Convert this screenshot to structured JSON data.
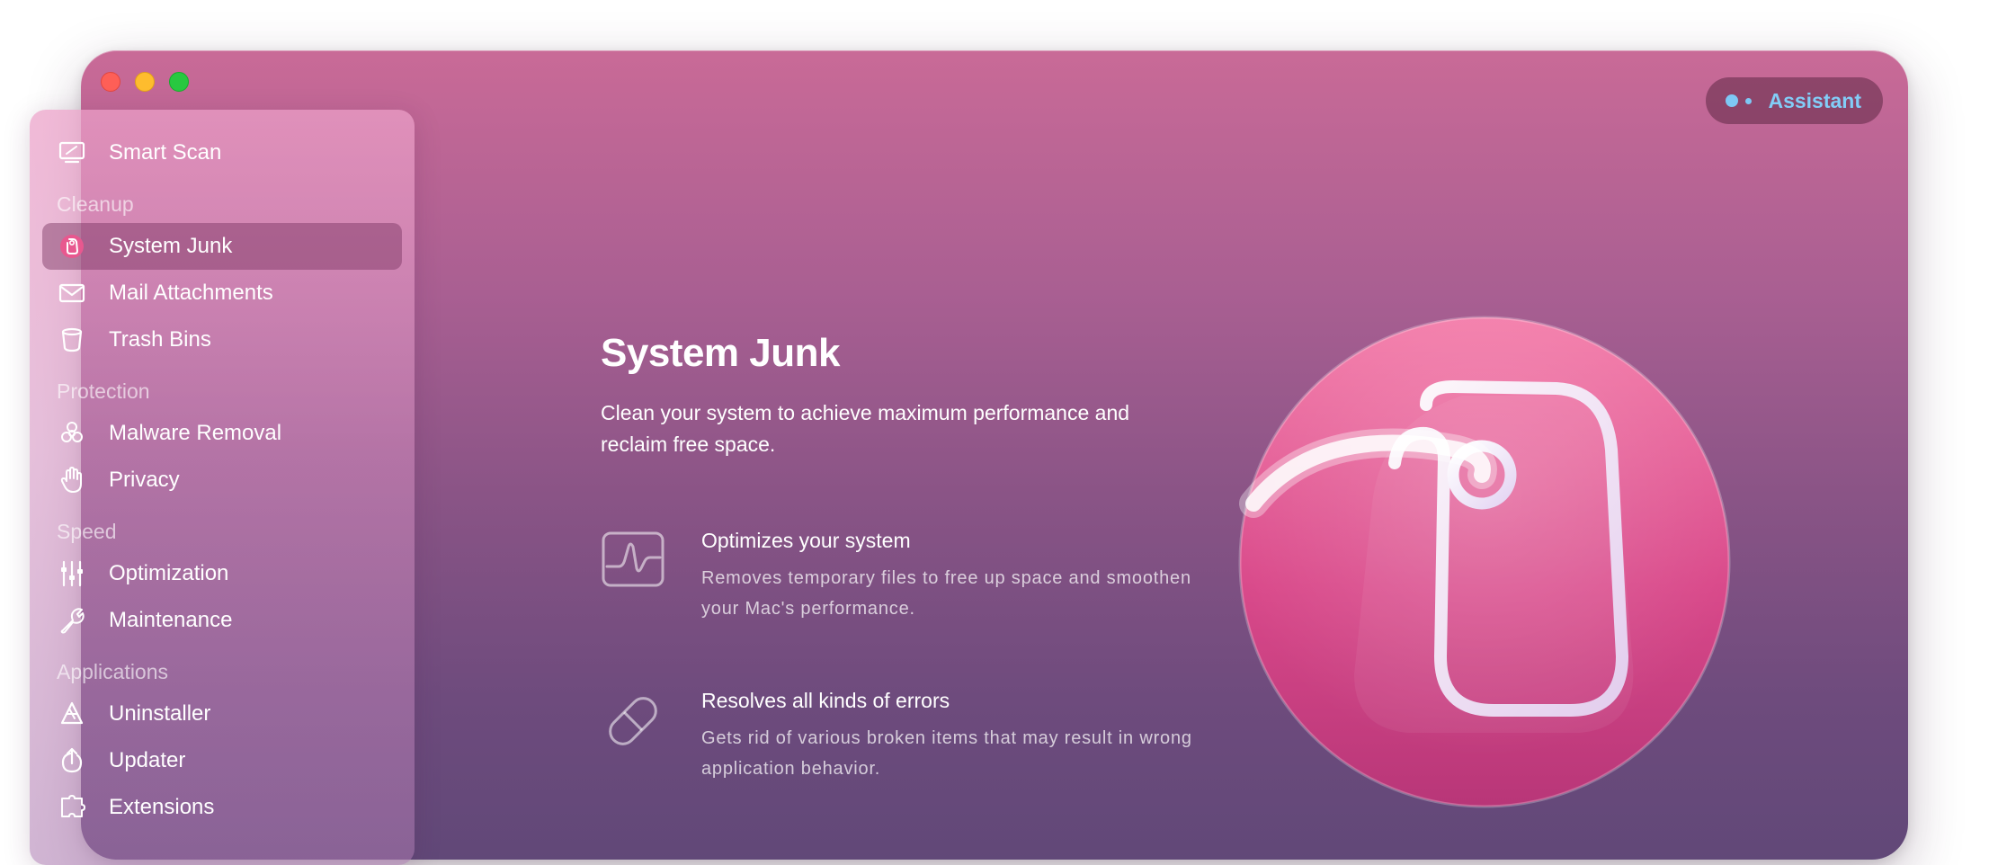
{
  "window": {
    "assistant_label": "Assistant"
  },
  "sidebar": {
    "top_item": {
      "label": "Smart Scan",
      "icon": "smart-scan-icon"
    },
    "sections": [
      {
        "title": "Cleanup",
        "items": [
          {
            "label": "System Junk",
            "icon": "system-junk-icon",
            "active": true
          },
          {
            "label": "Mail Attachments",
            "icon": "envelope-icon"
          },
          {
            "label": "Trash Bins",
            "icon": "trash-bin-icon"
          }
        ]
      },
      {
        "title": "Protection",
        "items": [
          {
            "label": "Malware Removal",
            "icon": "biohazard-icon"
          },
          {
            "label": "Privacy",
            "icon": "hand-icon"
          }
        ]
      },
      {
        "title": "Speed",
        "items": [
          {
            "label": "Optimization",
            "icon": "sliders-icon"
          },
          {
            "label": "Maintenance",
            "icon": "wrench-icon"
          }
        ]
      },
      {
        "title": "Applications",
        "items": [
          {
            "label": "Uninstaller",
            "icon": "uninstaller-icon"
          },
          {
            "label": "Updater",
            "icon": "updater-icon"
          },
          {
            "label": "Extensions",
            "icon": "extensions-icon"
          }
        ]
      }
    ]
  },
  "main": {
    "title": "System Junk",
    "subtitle": "Clean your system to achieve maximum performance and reclaim free space.",
    "features": [
      {
        "title": "Optimizes your system",
        "description": "Removes temporary files to free up space and smoothen your Mac's performance.",
        "icon": "pulse-monitor-icon"
      },
      {
        "title": "Resolves all kinds of errors",
        "description": "Gets rid of various broken items that may result in wrong application behavior.",
        "icon": "pill-icon"
      }
    ],
    "hero_icon": "system-junk-hero-icon"
  },
  "colors": {
    "window_top": "#c96a97",
    "window_bottom": "#614878",
    "assistant_accent": "#82cdf7",
    "hero_pink": "#e8588f"
  }
}
